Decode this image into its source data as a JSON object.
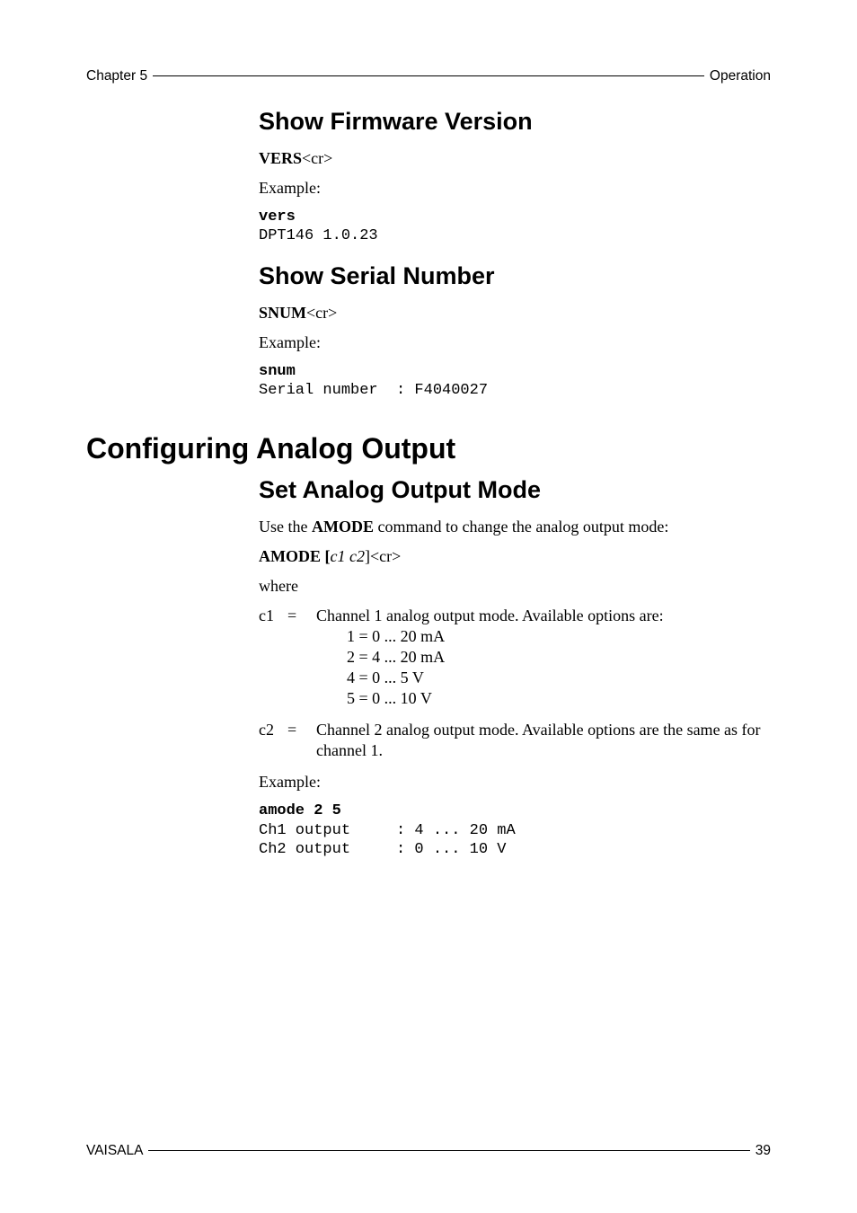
{
  "header": {
    "left": "Chapter 5",
    "right": "Operation"
  },
  "sections": {
    "show_firmware": {
      "heading": "Show Firmware Version",
      "cmd_bold": "VERS",
      "cmd_tail": "<cr>",
      "example_label": "Example:",
      "code_bold": "vers",
      "code_rest": "DPT146 1.0.23"
    },
    "show_serial": {
      "heading": "Show Serial Number",
      "cmd_bold": "SNUM",
      "cmd_tail": "<cr>",
      "example_label": "Example:",
      "code_bold": "snum",
      "code_rest": "Serial number  : F4040027"
    },
    "config_analog": {
      "heading": "Configuring Analog Output"
    },
    "set_amode": {
      "heading": "Set Analog Output Mode",
      "intro_pre": "Use the ",
      "intro_bold": "AMODE",
      "intro_post": " command to change the analog output mode:",
      "cmd_bold": "AMODE [",
      "cmd_italic": "c1 c2",
      "cmd_tail": "]<cr>",
      "where_label": "where",
      "c1": {
        "key": "c1",
        "eq": "=",
        "desc": "Channel 1 analog output mode. Available options are:",
        "opts": [
          "1 = 0 ... 20 mA",
          "2 = 4 ... 20 mA",
          "4 = 0 ... 5 V",
          "5 = 0 ... 10 V"
        ]
      },
      "c2": {
        "key": "c2",
        "eq": "=",
        "desc": "Channel 2 analog output mode. Available options are the same as for channel 1."
      },
      "example_label": "Example:",
      "code_bold": "amode 2 5",
      "code_rest": "Ch1 output     : 4 ... 20 mA\nCh2 output     : 0 ... 10 V"
    }
  },
  "footer": {
    "left": "VAISALA",
    "right": "39"
  }
}
